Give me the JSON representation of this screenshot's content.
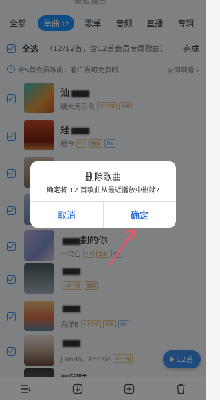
{
  "header": {
    "partial_title": "最近播放"
  },
  "tabs": [
    {
      "label": "全部"
    },
    {
      "label": "单曲",
      "count": "12"
    },
    {
      "label": "歌单"
    },
    {
      "label": "音频"
    },
    {
      "label": "直播"
    },
    {
      "label": "专辑"
    }
  ],
  "selection": {
    "select_all": "全选",
    "note": "（12/12首，含12首会员专属歌曲）",
    "done": "完成"
  },
  "vip_notice": {
    "icon": "vip-icon",
    "text": "含5首会员歌曲，看广告可免费听",
    "watch": "立即观看 ›"
  },
  "songs": [
    {
      "title": "汕",
      "artist": "跳大海乐队",
      "badges": [
        "VIP下载",
        "独家"
      ]
    },
    {
      "title": "矬",
      "artist": "程今",
      "badges": [
        "VIP",
        "独家",
        "MV"
      ]
    },
    {
      "title": "",
      "artist": "",
      "badges": []
    },
    {
      "title": "",
      "artist": "",
      "badges": []
    },
    {
      "title": "劃的你",
      "artist": "一只白",
      "badges": [
        "VIP",
        "独家",
        "MV"
      ]
    },
    {
      "title": "",
      "artist": "",
      "badges": [
        "VIP下载",
        "独家"
      ]
    },
    {
      "title": "",
      "artist": "海洋B",
      "badges": [
        "VIP下载",
        "独家",
        "MV"
      ]
    },
    {
      "title": "",
      "artist": "J    ando、kenzie",
      "badges": [
        "VIP下载"
      ]
    },
    {
      "title": "生回味",
      "artist": "",
      "badges": []
    }
  ],
  "play_all": {
    "label": "12首"
  },
  "dialog": {
    "title": "删除歌曲",
    "message": "确定将 12 首歌曲从最近播放中删除?",
    "cancel": "取消",
    "confirm": "确定"
  },
  "colors": {
    "accent": "#1e90ff",
    "dialog_button": "#2b6fd6",
    "arrow": "#e8566a"
  }
}
